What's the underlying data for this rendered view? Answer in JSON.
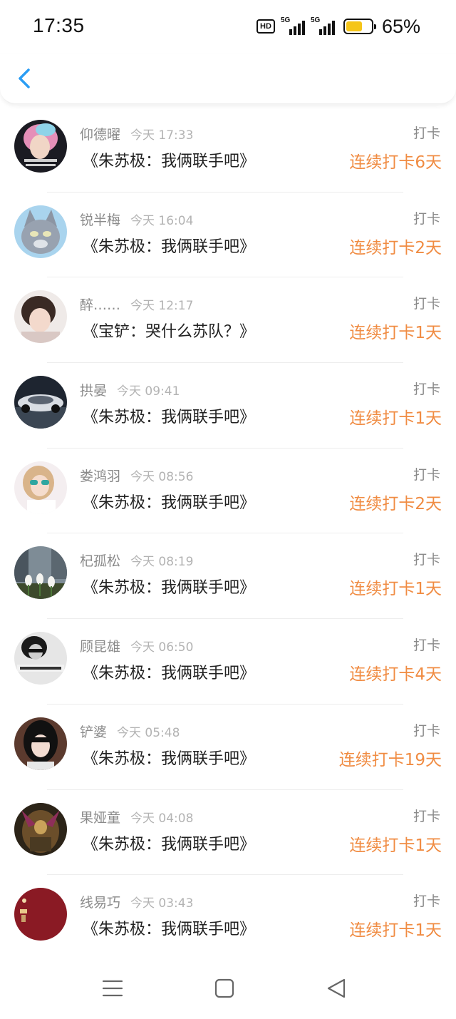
{
  "status_bar": {
    "time": "17:35",
    "hd_label": "HD",
    "signal1_label": "5G",
    "signal2_label": "5G",
    "battery_percent": "65%",
    "battery_level": 0.65,
    "icons": [
      "hd-icon",
      "signal-5g-icon",
      "signal-5g-icon",
      "battery-icon"
    ]
  },
  "header": {
    "back_icon": "chevron-left-icon",
    "accent_color": "#2a9df4"
  },
  "colors": {
    "streak": "#f08c43",
    "muted": "#8a8a8a",
    "text": "#222222"
  },
  "entries": [
    {
      "name": "仰德曜",
      "time": "今天 17:33",
      "book": "《朱苏极：我俩联手吧》",
      "tag": "打卡",
      "streak": "连续打卡6天",
      "avatar": "avatar-pink-hair"
    },
    {
      "name": "锐半梅",
      "time": "今天 16:04",
      "book": "《朱苏极：我俩联手吧》",
      "tag": "打卡",
      "streak": "连续打卡2天",
      "avatar": "avatar-cartoon-cat"
    },
    {
      "name": "醉……",
      "time": "今天 12:17",
      "book": "《宝铲：哭什么苏队？》",
      "tag": "打卡",
      "streak": "连续打卡1天",
      "avatar": "avatar-girl"
    },
    {
      "name": "拱晏",
      "time": "今天 09:41",
      "book": "《朱苏极：我俩联手吧》",
      "tag": "打卡",
      "streak": "连续打卡1天",
      "avatar": "avatar-car"
    },
    {
      "name": "娄鸿羽",
      "time": "今天 08:56",
      "book": "《朱苏极：我俩联手吧》",
      "tag": "打卡",
      "streak": "连续打卡2天",
      "avatar": "avatar-woman-sunglasses"
    },
    {
      "name": "杞孤松",
      "time": "今天 08:19",
      "book": "《朱苏极：我俩联手吧》",
      "tag": "打卡",
      "streak": "连续打卡1天",
      "avatar": "avatar-tulips"
    },
    {
      "name": "顾昆雄",
      "time": "今天 06:50",
      "book": "《朱苏极：我俩联手吧》",
      "tag": "打卡",
      "streak": "连续打卡4天",
      "avatar": "avatar-bw-portrait"
    },
    {
      "name": "铲婆",
      "time": "今天 05:48",
      "book": "《朱苏极：我俩联手吧》",
      "tag": "打卡",
      "streak": "连续打卡19天",
      "avatar": "avatar-dark-hair"
    },
    {
      "name": "果娅童",
      "time": "今天 04:08",
      "book": "《朱苏极：我俩联手吧》",
      "tag": "打卡",
      "streak": "连续打卡1天",
      "avatar": "avatar-warrior"
    },
    {
      "name": "线易巧",
      "time": "今天 03:43",
      "book": "《朱苏极：我俩联手吧》",
      "tag": "打卡",
      "streak": "连续打卡1天",
      "avatar": "avatar-red"
    }
  ],
  "bottom_nav": {
    "icons": [
      "menu-icon",
      "home-square-icon",
      "back-triangle-icon"
    ]
  }
}
